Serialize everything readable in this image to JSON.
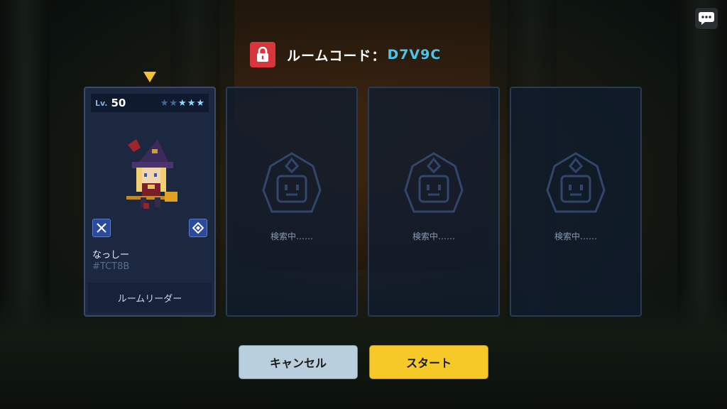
{
  "header": {
    "room_label": "ルームコード：",
    "room_code": "D7V9C",
    "lock_icon": "lock-icon",
    "lock_color": "#d8363d",
    "code_color": "#4fc3e8"
  },
  "chat_button": {
    "icon": "chat-bubble-icon"
  },
  "slots": [
    {
      "state": "filled",
      "level_prefix": "Lv.",
      "level": "50",
      "stars": "★★★★★",
      "stars_lit": 3,
      "stars_total": 5,
      "weapon_icon": "swords-icon",
      "class_icon": "diamond-emblem-icon",
      "name": "なっしー",
      "tag": "#TCT8B",
      "role": "ルームリーダー"
    },
    {
      "state": "searching",
      "status": "検索中……"
    },
    {
      "state": "searching",
      "status": "検索中……"
    },
    {
      "state": "searching",
      "status": "検索中……"
    }
  ],
  "buttons": {
    "cancel": "キャンセル",
    "start": "スタート"
  },
  "colors": {
    "start_button": "#f7c928",
    "cancel_button": "#b9cfdd",
    "selection_indicator": "#f2c230"
  }
}
